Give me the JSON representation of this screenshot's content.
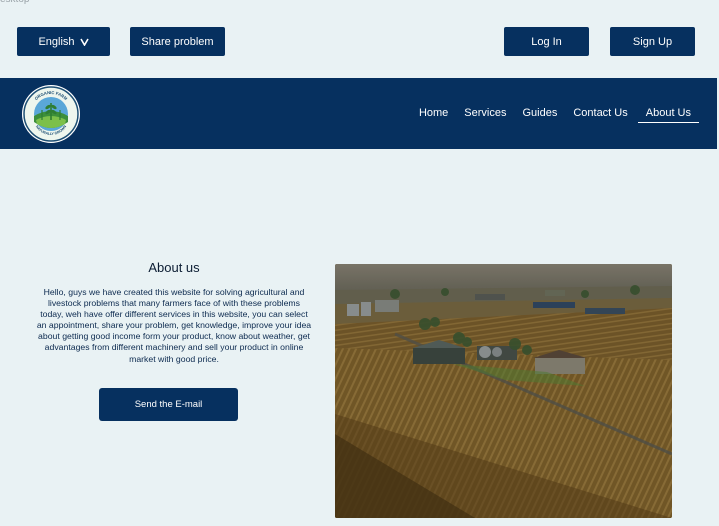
{
  "frame": {
    "label": "esktop"
  },
  "topbar": {
    "language_label": "English",
    "share_label": "Share problem",
    "login_label": "Log In",
    "signup_label": "Sign Up"
  },
  "nav": {
    "logo_text_top": "ORGANIC FARM",
    "logo_text_bottom": "NATURALLY GROWN",
    "links": [
      "Home",
      "Services",
      "Guides",
      "Contact Us",
      "About Us"
    ],
    "active": "About Us"
  },
  "about": {
    "title": "About us",
    "body": "Hello, guys we have created this website for solving agricultural and livestock problems that many farmers face of with these problems today, weh have offer different services in this website, you can select an appointment, share your problem, get knowledge, improve your idea about getting good income form your product, know about weather, get advantages from different machinery and sell your product in online market with good price.",
    "email_label": "Send the E-mail"
  },
  "colors": {
    "navy": "#06305f",
    "background": "#e9f2f4",
    "text": "#0c2a4f"
  },
  "icons": {
    "language_chevron": "chevron-down-icon",
    "logo": "organic-farm-logo"
  }
}
